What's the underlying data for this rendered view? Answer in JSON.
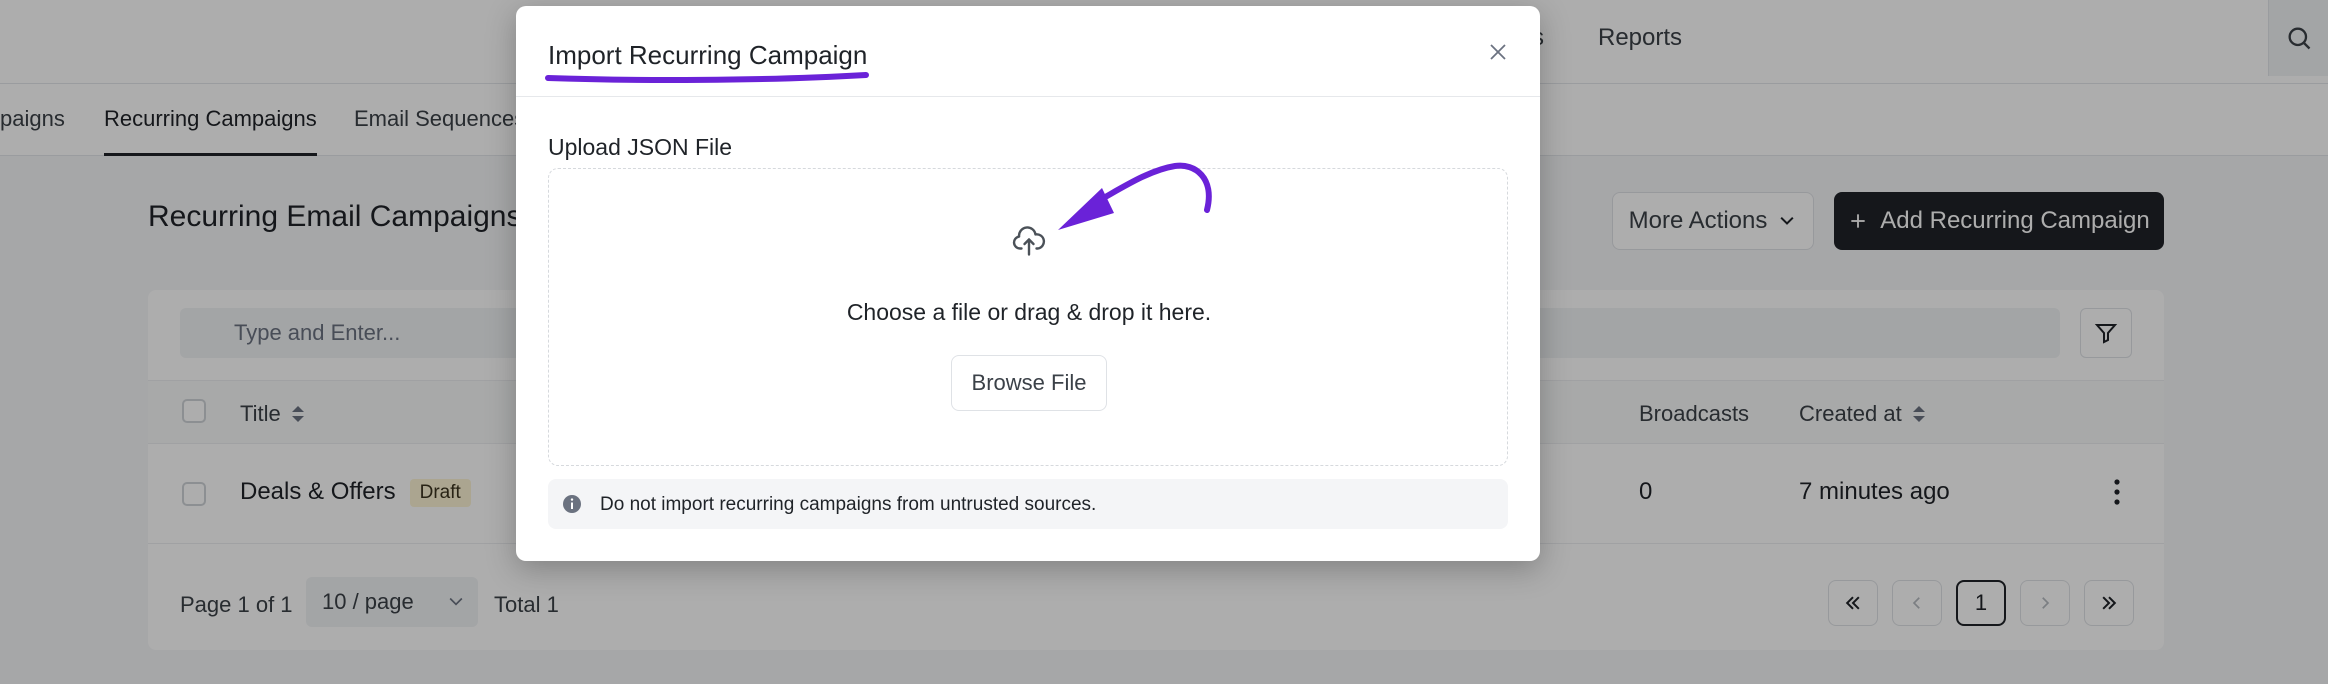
{
  "topnav": {
    "item_partial": "s",
    "reports": "Reports"
  },
  "subnav": {
    "tabs": [
      {
        "label": "paigns"
      },
      {
        "label": "Recurring Campaigns"
      },
      {
        "label": "Email Sequences"
      }
    ]
  },
  "page": {
    "title": "Recurring Email Campaigns",
    "more_actions": "More Actions",
    "add_button": "Add Recurring Campaign"
  },
  "table": {
    "search_placeholder": "Type and Enter...",
    "columns": {
      "title": "Title",
      "broadcasts": "Broadcasts",
      "created_at": "Created at"
    },
    "rows": [
      {
        "title": "Deals & Offers",
        "status": "Draft",
        "broadcasts": "0",
        "created_at": "7 minutes ago"
      }
    ],
    "pagination": {
      "page_text": "Page 1 of 1",
      "page_size": "10 / page",
      "total": "Total 1",
      "current_page": "1"
    }
  },
  "modal": {
    "title": "Import Recurring Campaign",
    "upload_label": "Upload JSON File",
    "drop_text": "Choose a file or drag & drop it here.",
    "browse_button": "Browse File",
    "notice": "Do not import recurring campaigns from untrusted sources."
  },
  "colors": {
    "annotation": "#6a22d8",
    "dark_button": "#1f2328",
    "draft_badge": "#fdf3d4"
  },
  "icons": [
    "search-icon",
    "filter-icon",
    "sort-icon",
    "kebab-icon",
    "chevron-down-icon",
    "double-left-icon",
    "left-icon",
    "right-icon",
    "double-right-icon",
    "close-icon",
    "cloud-upload-icon",
    "info-icon",
    "plus-icon"
  ]
}
